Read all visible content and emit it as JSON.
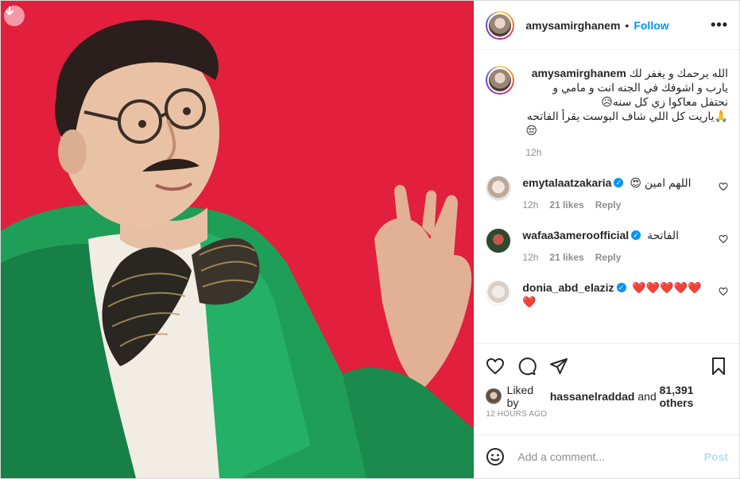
{
  "post": {
    "author": "amysamirghanem",
    "follow_label": "Follow",
    "more_label": "•••",
    "dot": "•"
  },
  "caption": {
    "user": "amysamirghanem",
    "line1": "الله يرحمك و يغفر لك",
    "line2": "يارب و اشوفك في الجنه انت و مامي و",
    "line3": "نحتفل معاكوا زي كل سنه😥",
    "line4": "🙏ياريت كل اللي شاف البوست يقرأ الفاتحه",
    "line5": "😔",
    "time": "12h"
  },
  "comments": [
    {
      "user": "emytalaatzakaria",
      "verified": true,
      "text": "اللهم امين 😍",
      "time": "12h",
      "likes": "21 likes",
      "reply": "Reply"
    },
    {
      "user": "wafaa3ameroofficial",
      "verified": true,
      "text": "الفاتحة",
      "time": "12h",
      "likes": "21 likes",
      "reply": "Reply"
    },
    {
      "user": "donia_abd_elaziz",
      "verified": true,
      "text": "❤️❤️❤️❤️❤️",
      "text2": "❤️"
    }
  ],
  "likes": {
    "prefix": "Liked by",
    "user": "hassanelraddad",
    "joiner": "and",
    "count": "81,391 others"
  },
  "timestamp": "12 HOURS AGO",
  "add_comment": {
    "placeholder": "Add a comment...",
    "post_label": "Post"
  },
  "colors": {
    "accent": "#0095f6",
    "photo_background": "#e21f3c",
    "jacket": "#1f9e57"
  },
  "icons": [
    "download-icon",
    "more-icon",
    "heart-icon",
    "comment-icon",
    "share-icon",
    "bookmark-icon",
    "emoji-icon"
  ]
}
